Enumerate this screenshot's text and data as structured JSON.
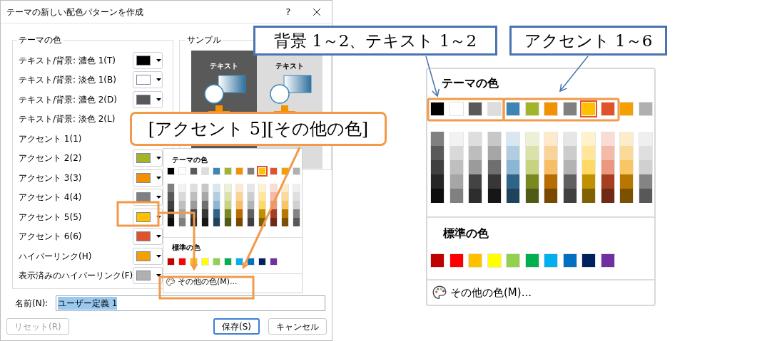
{
  "dialog": {
    "title": "テーマの新しい配色パターンを作成",
    "help": "?",
    "theme_group": {
      "title": "テーマの色",
      "rows": [
        {
          "label": "テキスト/背景: 濃色 1(T)",
          "color": "#000000"
        },
        {
          "label": "テキスト/背景: 淡色 1(B)",
          "color": "#ffffff"
        },
        {
          "label": "テキスト/背景: 濃色 2(D)",
          "color": "#595959"
        },
        {
          "label": "テキスト/背景: 淡色 2(L)"
        },
        {
          "label": "アクセント 1(1)"
        },
        {
          "label": "アクセント 2(2)",
          "color": "#a2b52a"
        },
        {
          "label": "アクセント 3(3)",
          "color": "#f39200"
        },
        {
          "label": "アクセント 4(4)",
          "color": "#808080"
        },
        {
          "label": "アクセント 5(5)",
          "color": "#ffc000"
        },
        {
          "label": "アクセント 6(6)",
          "color": "#e0522a"
        },
        {
          "label": "ハイパーリンク(H)",
          "color": "#f5a000"
        },
        {
          "label": "表示済みのハイパーリンク(F)",
          "color": "#b0b0b0"
        }
      ]
    },
    "sample_group": {
      "title": "サンプル",
      "previews": [
        {
          "label": "テキスト",
          "kind": "dark"
        },
        {
          "label": "テキスト",
          "kind": "light"
        }
      ]
    },
    "name_field": {
      "label": "名前(N):",
      "value": "ユーザー定義 1",
      "text_selected": true
    },
    "buttons": [
      {
        "label": "リセット(R)",
        "disabled": true,
        "default": false
      },
      {
        "label": "保存(S)",
        "disabled": false,
        "default": true
      },
      {
        "label": "キャンセル",
        "disabled": false,
        "default": false
      }
    ]
  },
  "dialog_palette": {
    "theme_title": "テーマの色",
    "theme_colors": [
      {
        "color": "#000000",
        "selected": false
      },
      {
        "color": "#ffffff",
        "selected": false
      },
      {
        "color": "#595959",
        "selected": false
      },
      {
        "color": "#dddddd",
        "selected": false
      },
      {
        "color": "#3d85b5",
        "selected": false
      },
      {
        "color": "#a2b52a",
        "selected": false
      },
      {
        "color": "#f39200",
        "selected": false
      },
      {
        "color": "#808080",
        "selected": false
      },
      {
        "color": "#ffc000",
        "selected": true
      },
      {
        "color": "#e0522a",
        "selected": false
      },
      {
        "color": "#f5a000",
        "selected": false
      },
      {
        "color": "#b0b0b0",
        "selected": false
      }
    ],
    "standard_title": "標準の色",
    "standard_colors": [
      {
        "color": "#c00000"
      },
      {
        "color": "#ff0000"
      },
      {
        "color": "#ffc000"
      },
      {
        "color": "#ffff00"
      },
      {
        "color": "#92d050"
      },
      {
        "color": "#00b050"
      },
      {
        "color": "#00b0f0"
      },
      {
        "color": "#0070c0"
      },
      {
        "color": "#002060"
      },
      {
        "color": "#7030a0"
      }
    ],
    "more_label": "その他の色(M)..."
  },
  "zoomed_palette": {
    "theme_title": "テーマの色",
    "theme_colors": [
      {
        "color": "#000000",
        "selected": false
      },
      {
        "color": "#ffffff",
        "selected": false
      },
      {
        "color": "#595959",
        "selected": false
      },
      {
        "color": "#dddddd",
        "selected": false
      },
      {
        "color": "#3d85b5",
        "selected": false
      },
      {
        "color": "#a2b52a",
        "selected": false
      },
      {
        "color": "#f39200",
        "selected": false
      },
      {
        "color": "#808080",
        "selected": false
      },
      {
        "color": "#ffc000",
        "selected": true
      },
      {
        "color": "#e0522a",
        "selected": false
      },
      {
        "color": "#f5a000",
        "selected": false
      },
      {
        "color": "#b0b0b0",
        "selected": false
      }
    ],
    "standard_title": "標準の色",
    "standard_colors": [
      {
        "color": "#c00000"
      },
      {
        "color": "#ff0000"
      },
      {
        "color": "#ffc000"
      },
      {
        "color": "#ffff00"
      },
      {
        "color": "#92d050"
      },
      {
        "color": "#00b050"
      },
      {
        "color": "#00b0f0"
      },
      {
        "color": "#0070c0"
      },
      {
        "color": "#002060"
      },
      {
        "color": "#7030a0"
      }
    ],
    "more_label": "その他の色(M)..."
  },
  "callouts": [
    {
      "text": "[アクセント 5][その他の色]",
      "kind": "orange"
    },
    {
      "text": "背景 1～2、テキスト 1～2",
      "kind": "blue"
    },
    {
      "text": "アクセント 1～6",
      "kind": "blue"
    }
  ]
}
